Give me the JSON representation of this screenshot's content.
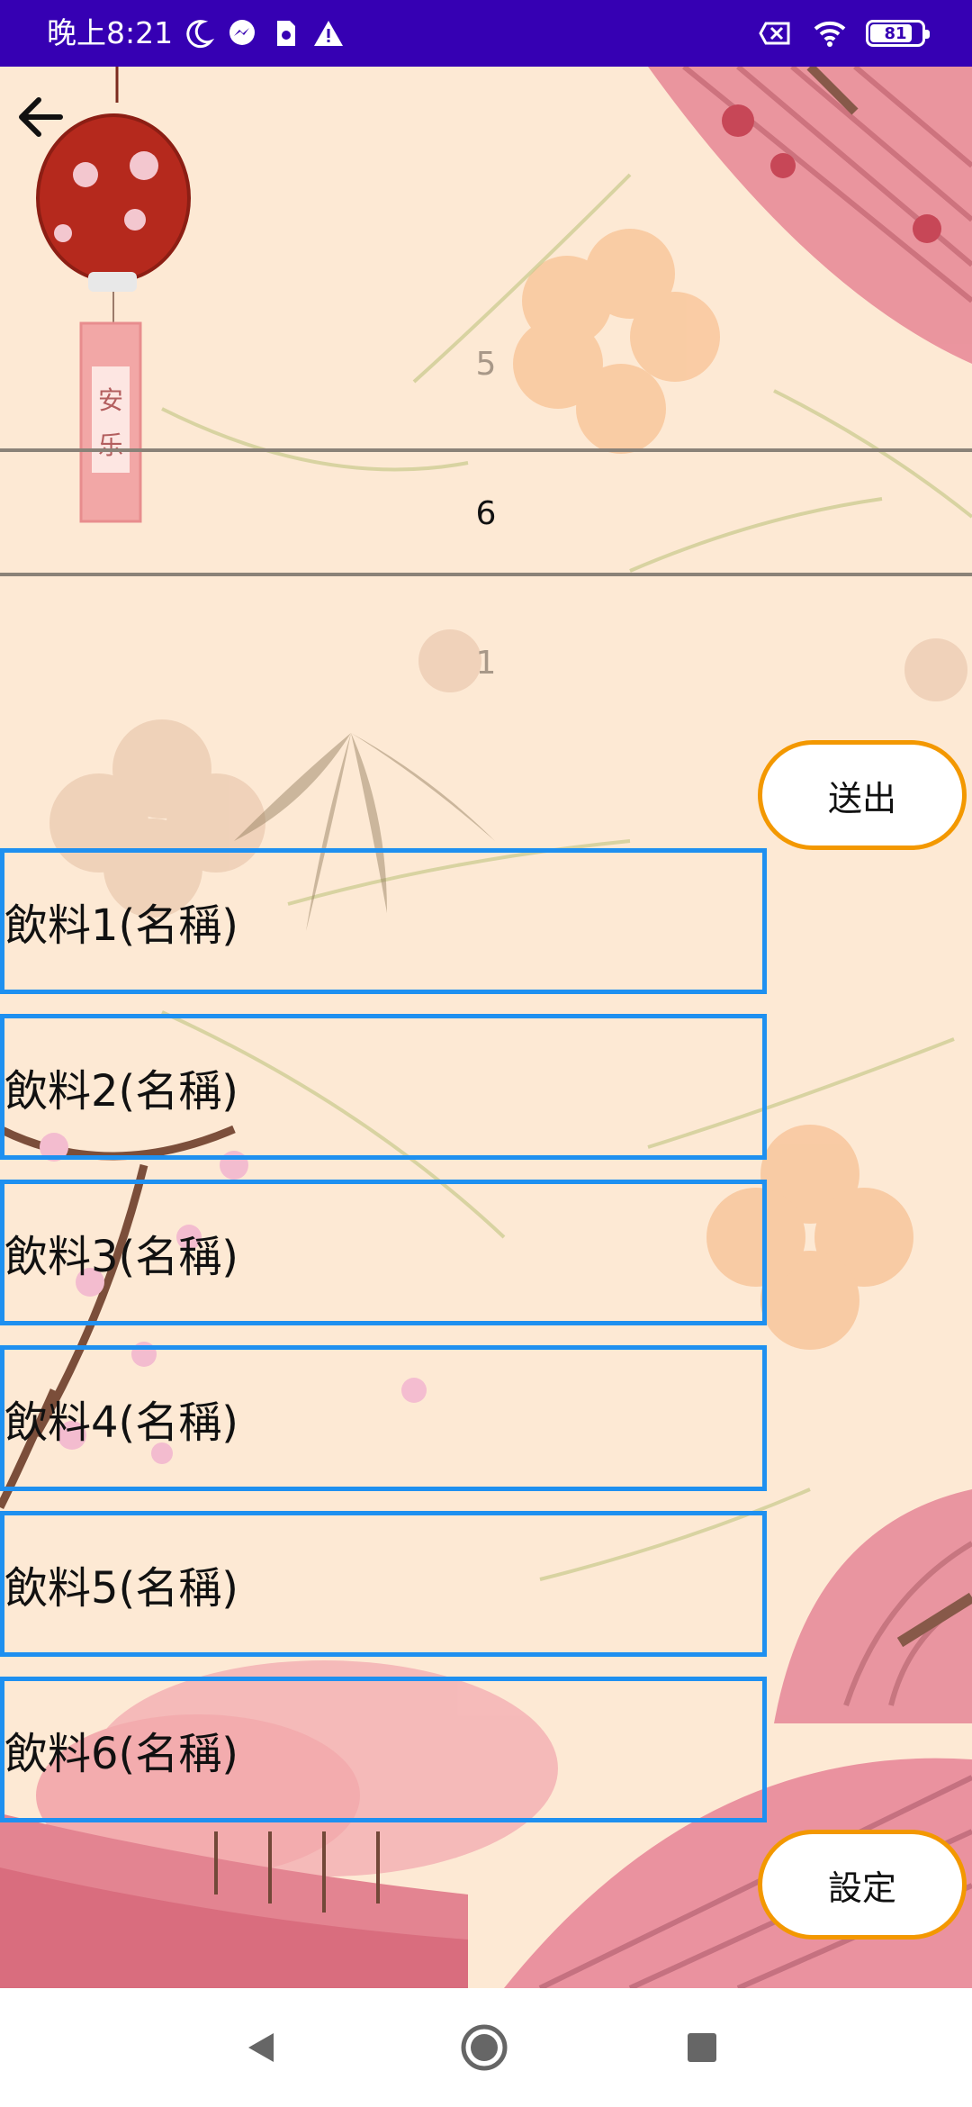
{
  "status_bar": {
    "time": "晚上8:21",
    "battery": "81",
    "icons": [
      "moon-icon",
      "messenger-icon",
      "sim-icon",
      "warning-icon",
      "no-sim-icon",
      "wifi-icon",
      "battery-icon"
    ]
  },
  "toolbar": {
    "back_icon": "arrow-left-icon"
  },
  "picker": {
    "previous": "5",
    "selected": "6",
    "next": "1"
  },
  "actions": {
    "send_label": "送出",
    "settings_label": "設定"
  },
  "drinks": [
    {
      "label": "飲料1(名稱)"
    },
    {
      "label": "飲料2(名稱)"
    },
    {
      "label": "飲料3(名稱)"
    },
    {
      "label": "飲料4(名稱)"
    },
    {
      "label": "飲料5(名稱)"
    },
    {
      "label": "飲料6(名稱)"
    }
  ],
  "colors": {
    "status_bar": "#3600b3",
    "background": "#fde9d4",
    "button_border": "#f39800",
    "field_border": "#1e90f0"
  },
  "nav_bar": {
    "icons": [
      "back-triangle-icon",
      "home-circle-icon",
      "recents-square-icon"
    ]
  }
}
